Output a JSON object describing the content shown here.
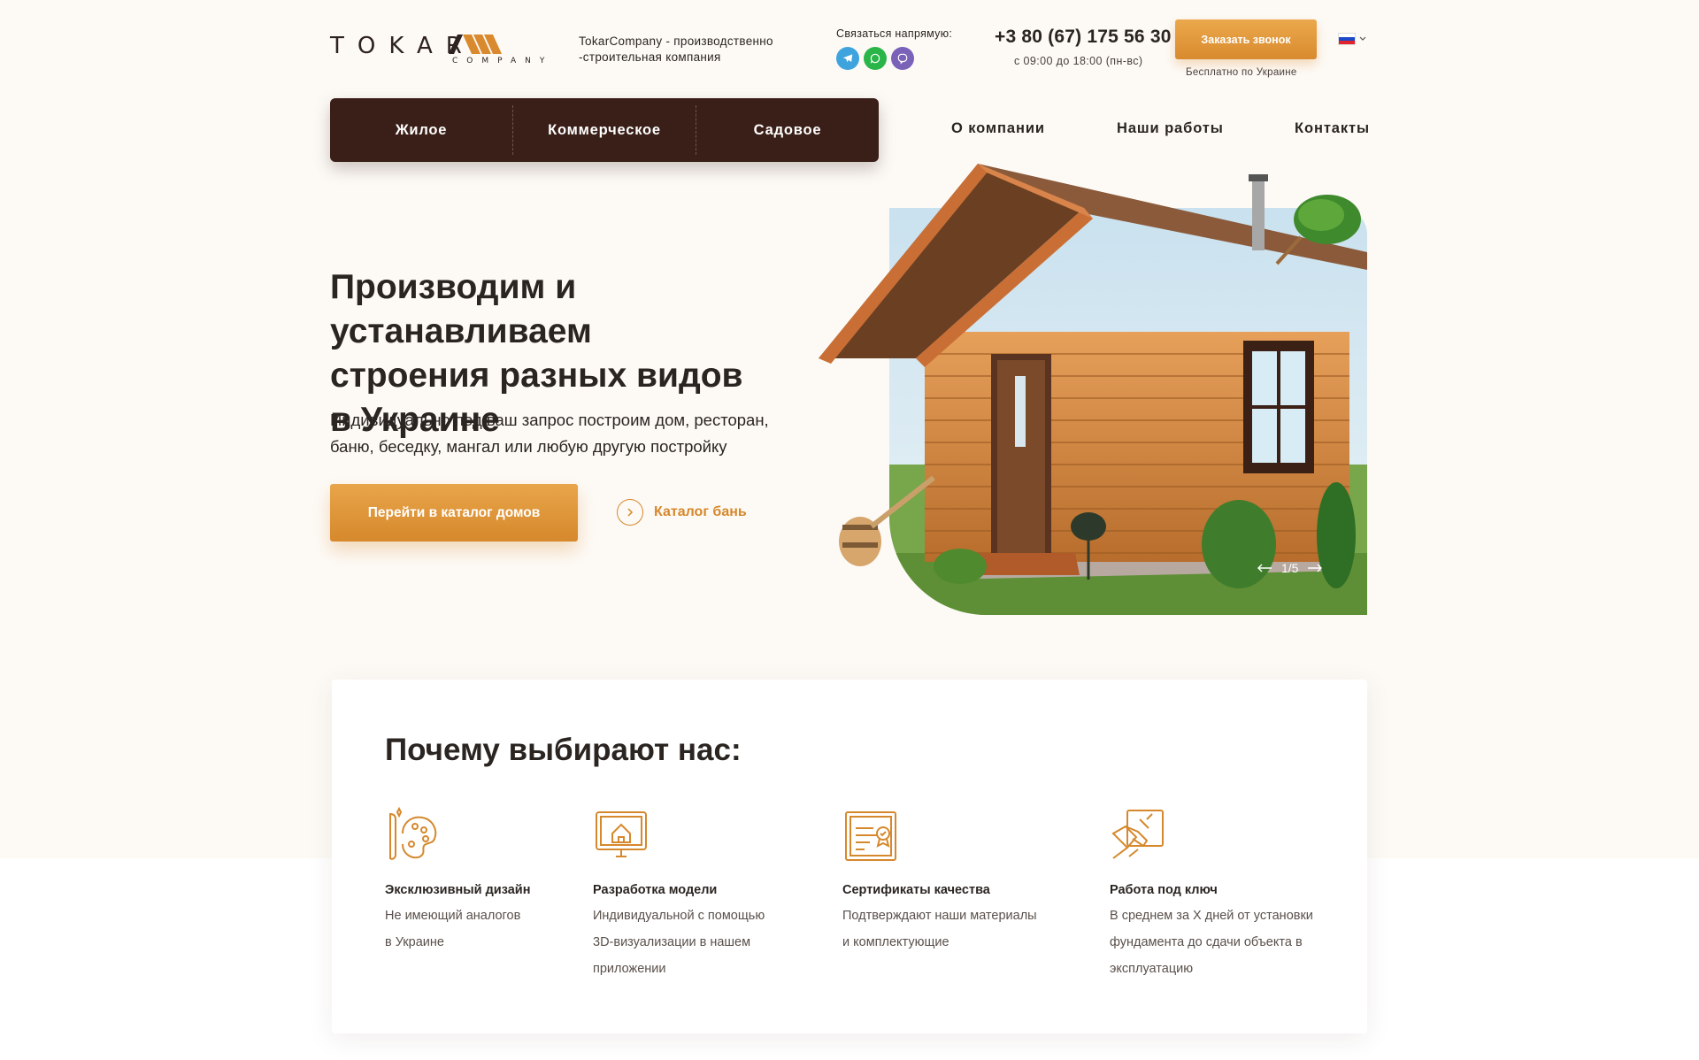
{
  "brand": {
    "logo_text": "TOKAR",
    "logo_sub": "COMPANY",
    "tagline": "TokarCompany - производственно -строительная компания"
  },
  "contacts": {
    "label": "Связаться напрямую:",
    "messengers": [
      "telegram-icon",
      "whatsapp-icon",
      "viber-icon"
    ],
    "phone": "+3 80 (67) 175 56 30",
    "hours": "с 09:00 до 18:00 (пн-вс)",
    "call_button": "Заказать звонок",
    "call_note": "Бесплатно по Украине"
  },
  "language": {
    "selected": "RU",
    "flag": "russia-flag-icon"
  },
  "category_nav": [
    "Жилое",
    "Коммерческое",
    "Садовое"
  ],
  "main_nav": [
    "О компании",
    "Наши работы",
    "Контакты"
  ],
  "hero": {
    "title_lines": [
      "Производим и устанавливаем",
      "строения разных видов",
      "в Украине"
    ],
    "subtitle_lines": [
      "Индивидуально под ваш запрос построим дом, ресторан,",
      "баню, беседку, мангал или любую другую постройку"
    ],
    "primary_button": "Перейти в каталог домов",
    "secondary_link": "Каталог бань",
    "slider": {
      "current": 1,
      "total": 5,
      "label": "1/5"
    }
  },
  "why": {
    "title": "Почему выбирают нас:",
    "features": [
      {
        "icon": "palette-icon",
        "title": "Эксклюзивный дизайн",
        "desc_lines": [
          "Не имеющий аналогов",
          "в Украине"
        ]
      },
      {
        "icon": "3d-model-monitor-icon",
        "title": "Разработка модели",
        "desc_lines": [
          "Индивидуальной с помощью",
          "3D-визуализации в нашем",
          "приложении"
        ]
      },
      {
        "icon": "certificate-icon",
        "title": "Сертификаты качества",
        "desc_lines": [
          "Подтверждают наши материалы",
          "и комплектующие"
        ]
      },
      {
        "icon": "turnkey-handshake-icon",
        "title": "Работа под ключ",
        "desc_lines": [
          "В среднем за Х дней от установки",
          "фундамента до сдачи объекта в",
          "эксплуатацию"
        ]
      }
    ]
  },
  "colors": {
    "accent": "#d98a2e",
    "nav_bg": "#3a1f18",
    "page_bg": "#fdfaf6",
    "text": "#2b2522"
  }
}
